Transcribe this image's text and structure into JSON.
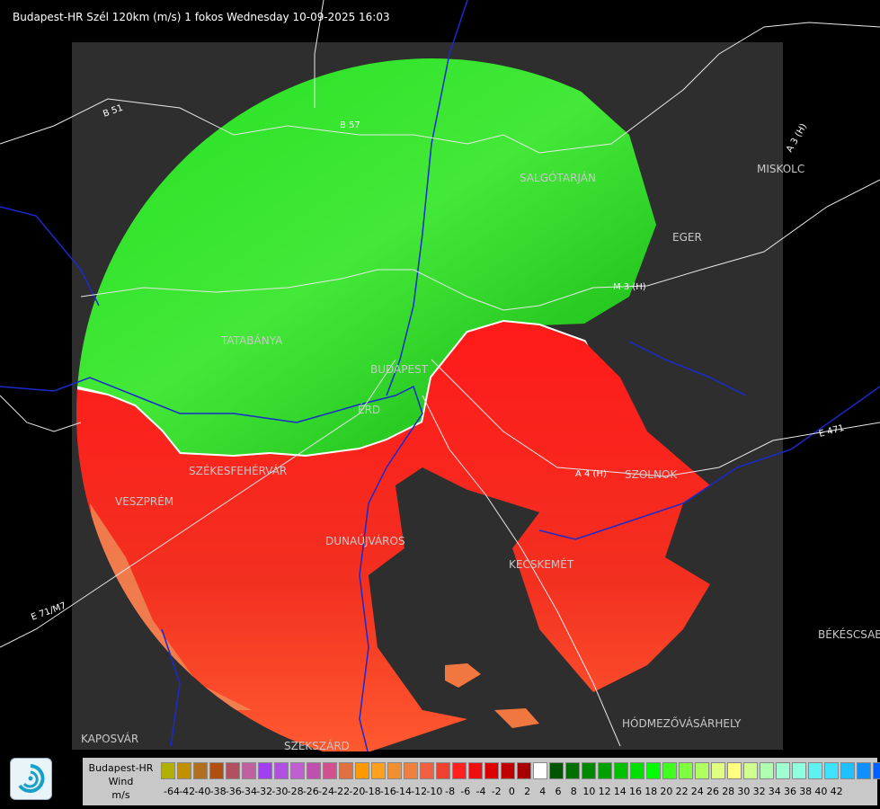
{
  "title": "Budapest-HR Szél 120km (m/s) 1 fokos Wednesday 10-09-2025 16:03",
  "cities": [
    "MISKOLC",
    "SALGÓTARJÁN",
    "EGER",
    "TATABÁNYA",
    "BUDAPEST",
    "ÉRD",
    "SZÉKESFEHÉRVÁR",
    "VESZPRÉM",
    "DUNAÚJVÁROS",
    "KECSKEMÉT",
    "SZOLNOK",
    "BÉKÉSCSABA",
    "HÓDMEZŐVÁSÁRHELY",
    "KAPOSVÁR",
    "SZEKSZÁRD"
  ],
  "roads": [
    "B 51",
    "B 57",
    "M 3 (H)",
    "A 3 (H)",
    "A 4 (H)",
    "E 471",
    "E 71/M7"
  ],
  "legend": {
    "line1": "Budapest-HR",
    "line2": "Wind",
    "line3": "m/s",
    "colors": [
      "#b0b000",
      "#c09000",
      "#b07020",
      "#b05010",
      "#b05060",
      "#c060a0",
      "#a040f0",
      "#b050e0",
      "#c060d0",
      "#c050b0",
      "#d05090",
      "#e07040",
      "#ff9900",
      "#ffa020",
      "#f09030",
      "#f08040",
      "#f06040",
      "#f04030",
      "#ff2020",
      "#ee1010",
      "#dd0000",
      "#c00000",
      "#a80000",
      "#ffffff",
      "#005500",
      "#007000",
      "#008800",
      "#00a000",
      "#00c000",
      "#00e000",
      "#00ff00",
      "#40ff20",
      "#80ff40",
      "#b0ff60",
      "#e0ff80",
      "#ffff80",
      "#d0ff90",
      "#b0ffb0",
      "#a0ffd0",
      "#90ffe0",
      "#60f0f0",
      "#40e0ff",
      "#20c0ff",
      "#1090ff",
      "#0060ff",
      "#0040e0",
      "#0010ff"
    ],
    "ticks": [
      "-64",
      "-42",
      "-40",
      "-38",
      "-36",
      "-34",
      "-32",
      "-30",
      "-28",
      "-26",
      "-24",
      "-22",
      "-20",
      "-18",
      "-16",
      "-14",
      "-12",
      "-10",
      "-8",
      "-6",
      "-4",
      "-2",
      "0",
      "2",
      "4",
      "6",
      "8",
      "10",
      "12",
      "14",
      "16",
      "18",
      "20",
      "22",
      "24",
      "26",
      "28",
      "30",
      "32",
      "34",
      "36",
      "38",
      "40",
      "42"
    ]
  }
}
